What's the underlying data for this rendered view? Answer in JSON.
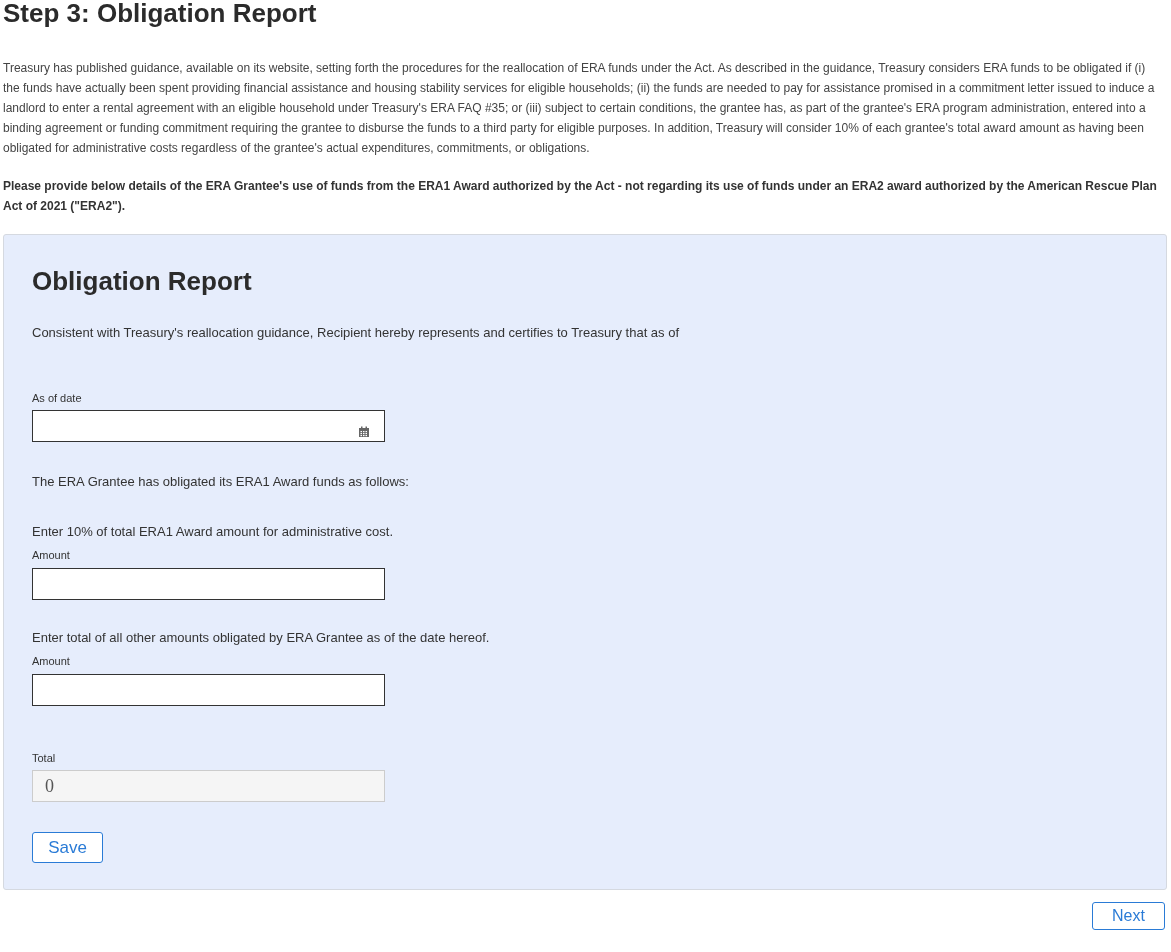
{
  "title": "Step 3: Obligation Report",
  "intro": "Treasury has published guidance, available on its website, setting forth the procedures for the reallocation of ERA funds under the Act. As described in the guidance, Treasury considers ERA funds to be obligated if (i) the funds have actually been spent providing financial assistance and housing stability services for eligible households; (ii) the funds are needed to pay for assistance promised in a commitment letter issued to induce a landlord to enter a rental agreement with an eligible household under Treasury's ERA FAQ #35; or (iii) subject to certain conditions, the grantee has, as part of the grantee's ERA program administration, entered into a binding agreement or funding commitment requiring the grantee to disburse the funds to a third party for eligible purposes. In addition, Treasury will consider 10% of each grantee's total award amount as having been obligated for administrative costs regardless of the grantee's actual expenditures, commitments, or obligations.",
  "instruction": "Please provide below details of the ERA Grantee's use of funds from the ERA1 Award authorized by the Act - not regarding its use of funds under an ERA2 award authorized by the American Rescue Plan Act of 2021 (\"ERA2\").",
  "card": {
    "title": "Obligation Report",
    "items": [
      {
        "kind": "text",
        "text": "Consistent with Treasury's reallocation guidance, Recipient hereby represents and certifies to Treasury that as of"
      },
      {
        "kind": "date",
        "label": "As of date"
      },
      {
        "kind": "text",
        "text": "The ERA Grantee has obligated its ERA1 Award funds as follows:"
      },
      {
        "kind": "text",
        "text": "Enter 10% of total ERA1 Award amount for administrative cost."
      },
      {
        "kind": "field",
        "label": "Amount",
        "disabled": false
      },
      {
        "kind": "text",
        "text": "Enter total of all other amounts obligated by ERA Grantee as of the date hereof."
      },
      {
        "kind": "field",
        "label": "Amount",
        "disabled": false
      },
      {
        "kind": "field",
        "label": "Total",
        "value": "0",
        "disabled": true
      }
    ],
    "save_button": "Save"
  },
  "next_button": "Next"
}
